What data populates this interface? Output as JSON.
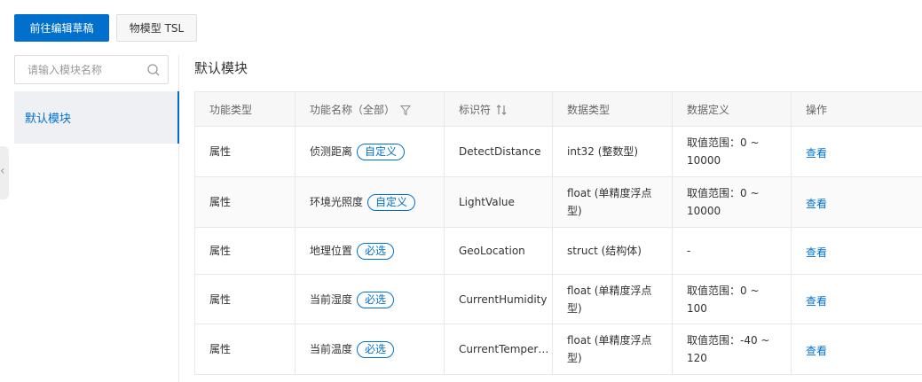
{
  "toolbar": {
    "goto_draft_label": "前往编辑草稿",
    "tsl_label": "物模型 TSL"
  },
  "sidebar": {
    "search_placeholder": "请输入模块名称",
    "modules": [
      {
        "label": "默认模块",
        "selected": true
      }
    ]
  },
  "main": {
    "module_title": "默认模块",
    "columns": [
      "功能类型",
      "功能名称（全部）",
      "标识符",
      "数据类型",
      "数据定义",
      "操作"
    ],
    "rows": [
      {
        "type": "属性",
        "name": "侦测距离",
        "tag": "自定义",
        "identifier": "DetectDistance",
        "data_type": "int32 (整数型)",
        "definition": "取值范围：0 ~ 10000",
        "action": "查看"
      },
      {
        "type": "属性",
        "name": "环境光照度",
        "tag": "自定义",
        "identifier": "LightValue",
        "data_type": "float (单精度浮点型)",
        "definition": "取值范围：0 ~ 10000",
        "action": "查看"
      },
      {
        "type": "属性",
        "name": "地理位置",
        "tag": "必选",
        "identifier": "GeoLocation",
        "data_type": "struct (结构体)",
        "definition": "-",
        "action": "查看"
      },
      {
        "type": "属性",
        "name": "当前湿度",
        "tag": "必选",
        "identifier": "CurrentHumidity",
        "data_type": "float (单精度浮点型)",
        "definition": "取值范围：0 ~ 100",
        "action": "查看"
      },
      {
        "type": "属性",
        "name": "当前温度",
        "tag": "必选",
        "identifier": "CurrentTemper…",
        "data_type": "float (单精度浮点型)",
        "definition": "取值范围：-40 ~ 120",
        "action": "查看"
      }
    ]
  },
  "colors": {
    "primary": "#0070cc",
    "header_bg": "#f7f7f7",
    "selected_bg": "#eef0f3"
  }
}
